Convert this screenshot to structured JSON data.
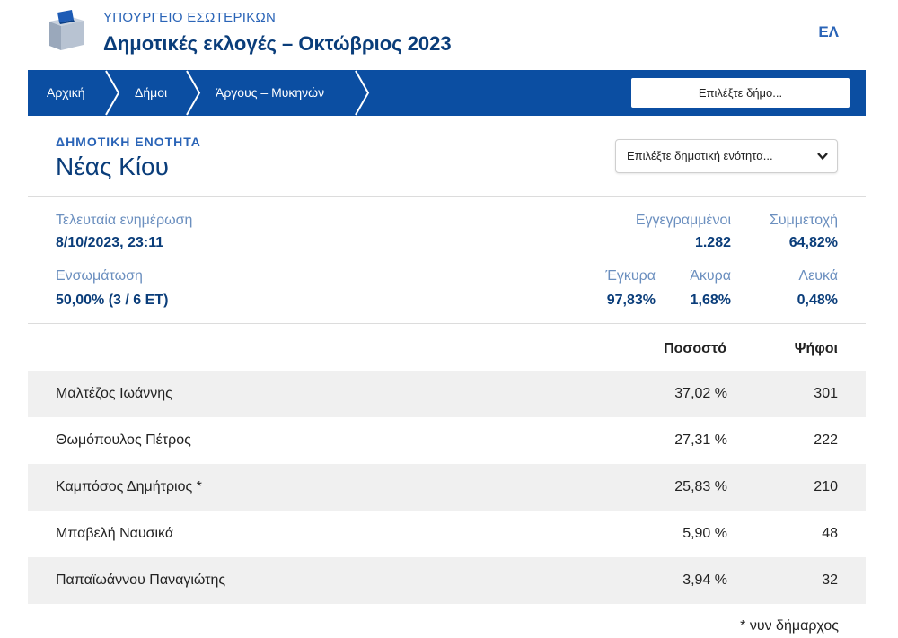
{
  "header": {
    "ministry": "ΥΠΟΥΡΓΕΙΟ ΕΣΩΤΕΡΙΚΩΝ",
    "election_title": "Δημοτικές εκλογές – Οκτώβριος 2023",
    "language": "ΕΛ",
    "logo_icon": "ballot-box-icon"
  },
  "breadcrumb": {
    "items": [
      {
        "label": "Αρχική"
      },
      {
        "label": "Δήμοι"
      },
      {
        "label": "Άργους – Μυκηνών"
      }
    ],
    "municipality_button": "Επιλέξτε δήμο..."
  },
  "unit": {
    "label": "ΔΗΜΟΤΙΚΗ ΕΝΟΤΗΤΑ",
    "name": "Νέας Κίου",
    "select_placeholder": "Επιλέξτε δημοτική ενότητα..."
  },
  "stats": {
    "last_update_label": "Τελευταία ενημέρωση",
    "last_update_value": "8/10/2023, 23:11",
    "registered_label": "Εγγεγραμμένοι",
    "registered_value": "1.282",
    "turnout_label": "Συμμετοχή",
    "turnout_value": "64,82%",
    "integration_label": "Ενσωμάτωση",
    "integration_value": "50,00% (3 / 6 ΕΤ)",
    "valid_label": "Έγκυρα",
    "valid_value": "97,83%",
    "invalid_label": "Άκυρα",
    "invalid_value": "1,68%",
    "blank_label": "Λευκά",
    "blank_value": "0,48%"
  },
  "results": {
    "col_percent": "Ποσοστό",
    "col_votes": "Ψήφοι",
    "rows": [
      {
        "name": "Μαλτέζος Ιωάννης",
        "percent": "37,02 %",
        "votes": "301"
      },
      {
        "name": "Θωμόπουλος Πέτρος",
        "percent": "27,31 %",
        "votes": "222"
      },
      {
        "name": "Καμπόσος Δημήτριος *",
        "percent": "25,83 %",
        "votes": "210"
      },
      {
        "name": "Μπαβελή Ναυσικά",
        "percent": "5,90 %",
        "votes": "48"
      },
      {
        "name": "Παπαϊωάννου Παναγιώτης",
        "percent": "3,94 %",
        "votes": "32"
      }
    ],
    "footnote": "* νυν δήμαρχος"
  },
  "colors": {
    "navbar": "#0b4ea2",
    "title": "#0a3d7a",
    "accent": "#2a64b7",
    "label": "#6b8fbf",
    "row_alt": "#f0f0f0"
  }
}
